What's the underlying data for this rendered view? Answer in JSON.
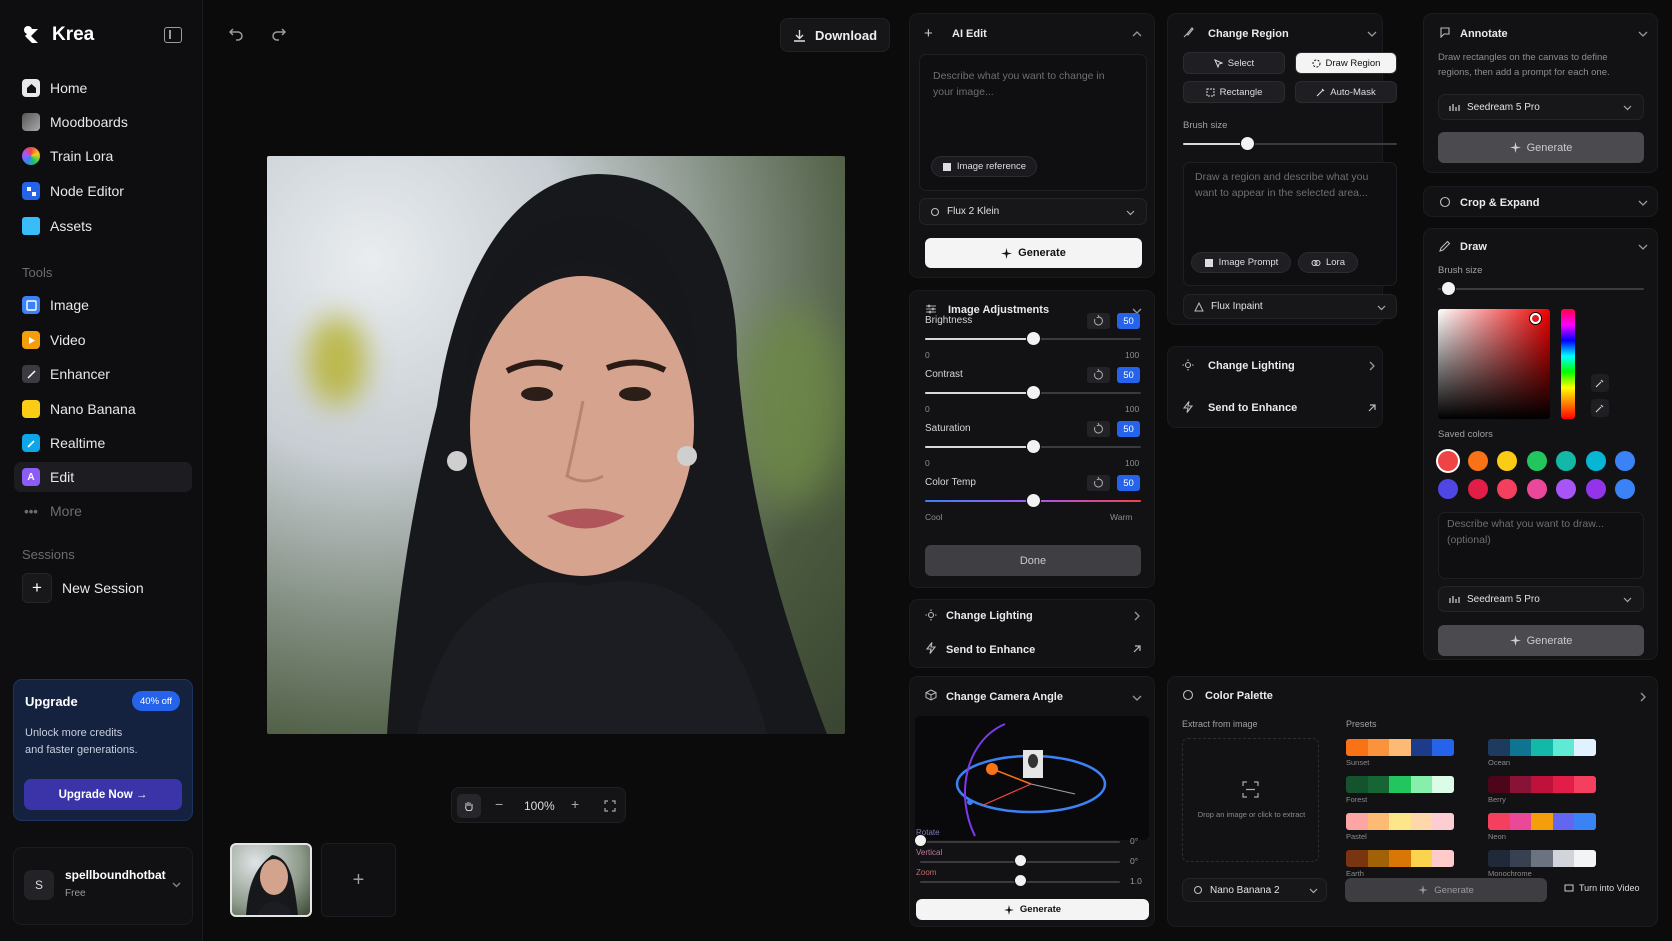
{
  "app": {
    "name": "Krea"
  },
  "sidebar": {
    "items": [
      {
        "label": "Home",
        "icon": "home-icon"
      },
      {
        "label": "Moodboards",
        "icon": "moodboards-icon"
      },
      {
        "label": "Train Lora",
        "icon": "train-lora-icon"
      },
      {
        "label": "Node Editor",
        "icon": "node-editor-icon"
      },
      {
        "label": "Assets",
        "icon": "folder-icon"
      }
    ],
    "tools_label": "Tools",
    "tools": [
      {
        "label": "Image",
        "icon": "image-icon"
      },
      {
        "label": "Video",
        "icon": "video-icon"
      },
      {
        "label": "Enhancer",
        "icon": "enhancer-icon"
      },
      {
        "label": "Nano Banana",
        "icon": "nano-banana-icon"
      },
      {
        "label": "Realtime",
        "icon": "realtime-icon"
      },
      {
        "label": "Edit",
        "icon": "edit-icon"
      },
      {
        "label": "More",
        "icon": "more-icon"
      }
    ],
    "sessions_label": "Sessions",
    "new_session": "New Session",
    "upgrade": {
      "title": "Upgrade",
      "badge": "40% off",
      "line1": "Unlock more credits",
      "line2": "and faster generations.",
      "button": "Upgrade Now →"
    },
    "user": {
      "initial": "S",
      "name": "spellboundhotbat",
      "plan": "Free"
    }
  },
  "toolbar": {
    "download_label": "Download"
  },
  "canvas": {
    "zoom": "100%"
  },
  "ai_edit": {
    "title": "AI Edit",
    "placeholder_line1": "Describe what you want to change in",
    "placeholder_line2": "your image...",
    "image_reference": "Image reference",
    "model": "Flux 2 Klein",
    "generate": "Generate"
  },
  "image_adjustments": {
    "title": "Image Adjustments",
    "sliders": [
      {
        "label": "Brightness",
        "value": "50",
        "min": "0",
        "max": "100",
        "level": 0.5
      },
      {
        "label": "Contrast",
        "value": "50",
        "min": "0",
        "max": "100",
        "level": 0.5
      },
      {
        "label": "Saturation",
        "value": "50",
        "min": "0",
        "max": "100",
        "level": 0.5
      },
      {
        "label": "Color Temp",
        "value": "50",
        "min": "Cool",
        "max": "Warm",
        "level": 0.5
      }
    ],
    "done": "Done"
  },
  "lighting_mid": {
    "change_lighting": "Change Lighting",
    "send_enhance": "Send to Enhance"
  },
  "camera_angle": {
    "title": "Change Camera Angle",
    "rotate_label": "Rotate",
    "rotate_value": "0°",
    "rotate_level": 0.0,
    "vertical_label": "Vertical",
    "vertical_value": "0°",
    "vertical_level": 0.5,
    "zoom_label": "Zoom",
    "zoom_value": "1.0",
    "zoom_level": 0.5,
    "generate": "Generate"
  },
  "change_region": {
    "title": "Change Region",
    "select": "Select",
    "draw_region": "Draw Region",
    "rectangle": "Rectangle",
    "auto_mask": "Auto-Mask",
    "brush_size_label": "Brush size",
    "brush_level": 0.3,
    "placeholder_line1": "Draw a region and describe what you",
    "placeholder_line2": "want to appear in the selected area...",
    "image_prompt": "Image Prompt",
    "lora": "Lora",
    "model": "Flux Inpaint"
  },
  "lighting_right": {
    "change_lighting": "Change Lighting",
    "send_enhance": "Send to Enhance"
  },
  "annotate": {
    "title": "Annotate",
    "desc_line1": "Draw rectangles on the canvas to define",
    "desc_line2": "regions, then add a prompt for each one.",
    "model": "Seedream 5 Pro",
    "generate": "Generate"
  },
  "crop_expand": {
    "title": "Crop & Expand"
  },
  "draw": {
    "title": "Draw",
    "brush_size_label": "Brush size",
    "brush_level": 0.05,
    "saved_colors_label": "Saved colors",
    "saved_colors": [
      "#ef4444",
      "#f97316",
      "#facc15",
      "#22c55e",
      "#14b8a6",
      "#06b6d4",
      "#3b82f6",
      "#4f46e5",
      "#e11d48",
      "#f43f5e",
      "#ec4899",
      "#a855f7",
      "#9333ea",
      "#3b82f6"
    ],
    "placeholder_line1": "Describe what you want to draw...",
    "placeholder_line2": "(optional)",
    "model": "Seedream 5 Pro",
    "generate": "Generate"
  },
  "color_palette": {
    "title": "Color Palette",
    "extract_label": "Extract from image",
    "drop_text": "Drop an image or click to extract",
    "presets_label": "Presets",
    "presets": [
      {
        "name": "Sunset",
        "colors": [
          "#f97316",
          "#fb923c",
          "#fdba74",
          "#1e3a8a",
          "#2563eb"
        ]
      },
      {
        "name": "Ocean",
        "colors": [
          "#1e3a5f",
          "#0e7490",
          "#14b8a6",
          "#5eead4",
          "#e0f2fe"
        ]
      },
      {
        "name": "Forest",
        "colors": [
          "#14532d",
          "#166534",
          "#22c55e",
          "#86efac",
          "#dcfce7"
        ]
      },
      {
        "name": "Berry",
        "colors": [
          "#4c0519",
          "#881337",
          "#be123c",
          "#e11d48",
          "#f43f5e"
        ]
      },
      {
        "name": "Pastel",
        "colors": [
          "#fca5a5",
          "#fdba74",
          "#fde68a",
          "#fed7aa",
          "#fecdd3"
        ]
      },
      {
        "name": "Neon",
        "colors": [
          "#f43f5e",
          "#ec4899",
          "#f59e0b",
          "#6366f1",
          "#3b82f6"
        ]
      },
      {
        "name": "Earth",
        "colors": [
          "#78350f",
          "#a16207",
          "#d97706",
          "#fcd34d",
          "#fecaca"
        ]
      },
      {
        "name": "Monochrome",
        "colors": [
          "#1f2937",
          "#374151",
          "#6b7280",
          "#d1d5db",
          "#f3f4f6"
        ]
      }
    ],
    "model": "Nano Banana 2",
    "generate": "Generate",
    "turn_into_video": "Turn into Video"
  }
}
